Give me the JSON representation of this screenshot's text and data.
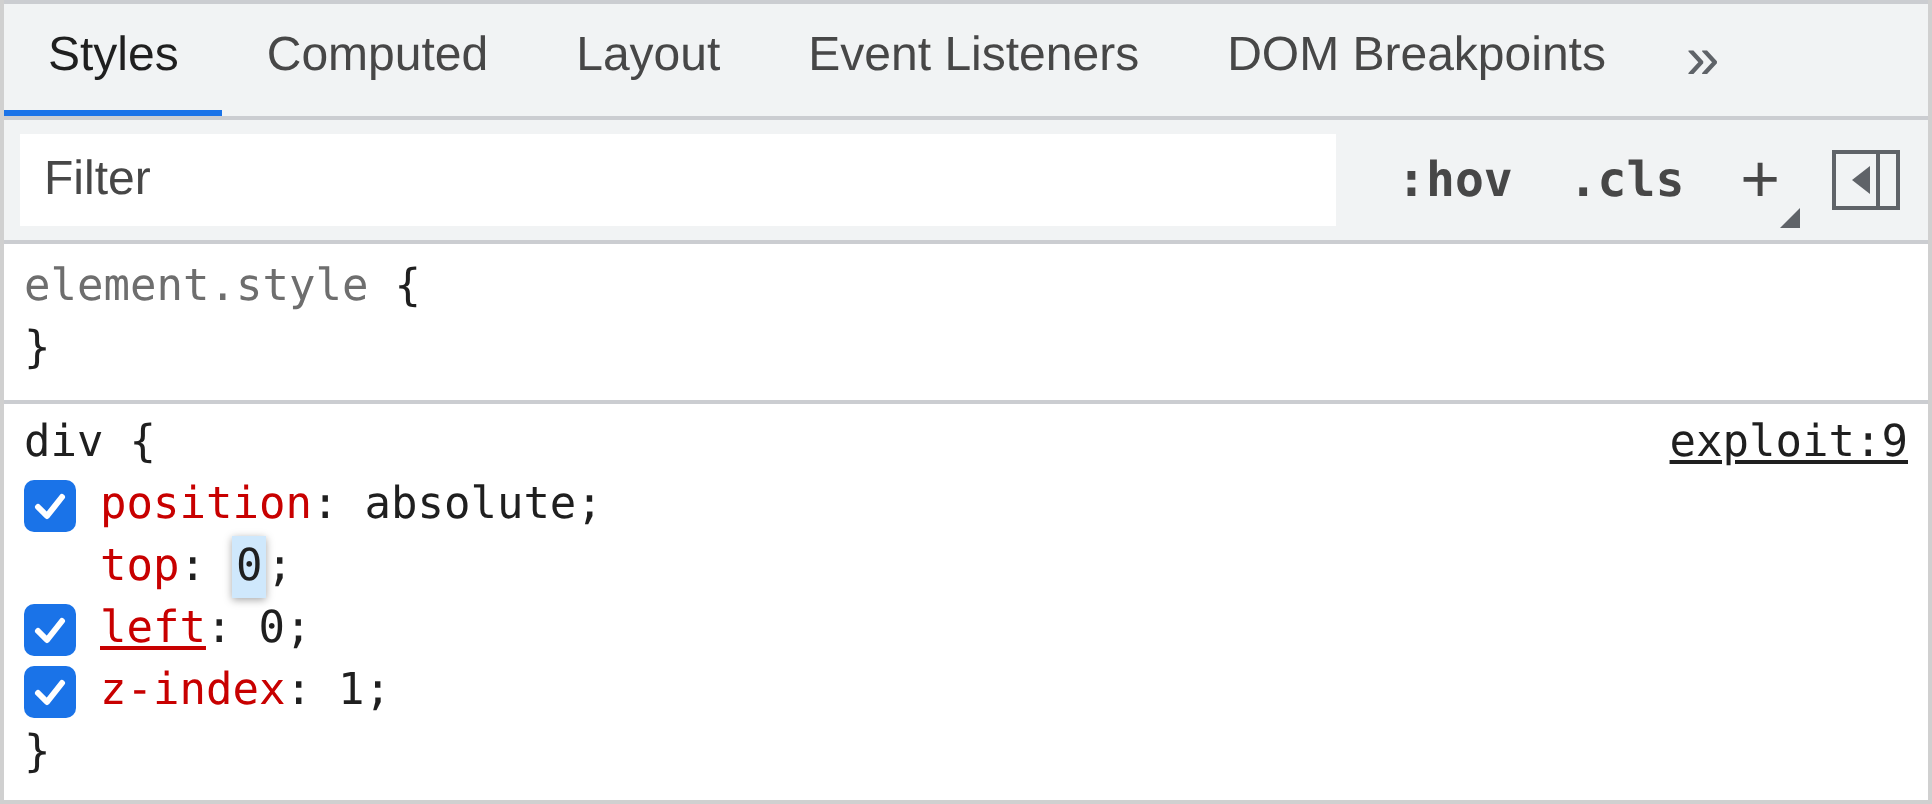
{
  "tabs": [
    {
      "label": "Styles",
      "selected": true
    },
    {
      "label": "Computed",
      "selected": false
    },
    {
      "label": "Layout",
      "selected": false
    },
    {
      "label": "Event Listeners",
      "selected": false
    },
    {
      "label": "DOM Breakpoints",
      "selected": false
    }
  ],
  "more_tabs": "»",
  "toolbar": {
    "filter": {
      "placeholder": "Filter"
    },
    "buttons": [
      ":hov",
      ".cls",
      "+"
    ]
  },
  "rules": [
    {
      "selector": "element.style",
      "open": "{",
      "close": "}",
      "inline": true
    },
    {
      "selector": "div",
      "open": "{",
      "close": "}",
      "inline": false,
      "source": "exploit:9",
      "declarations": [
        {
          "kind": "checkbox",
          "checked": true,
          "property": "position",
          "colon": ":",
          "value": "absolute;",
          "underlined": false
        },
        {
          "kind": "editing",
          "property": "top",
          "colon": ":",
          "value": "0",
          "after": ";",
          "underlined": false
        },
        {
          "kind": "checkbox",
          "checked": true,
          "property": "left",
          "colon": ":",
          "value": "0;",
          "underlined": true
        },
        {
          "kind": "checkbox",
          "checked": true,
          "property": "z-index",
          "colon": ":",
          "value": "1;",
          "underlined": false
        }
      ]
    }
  ]
}
